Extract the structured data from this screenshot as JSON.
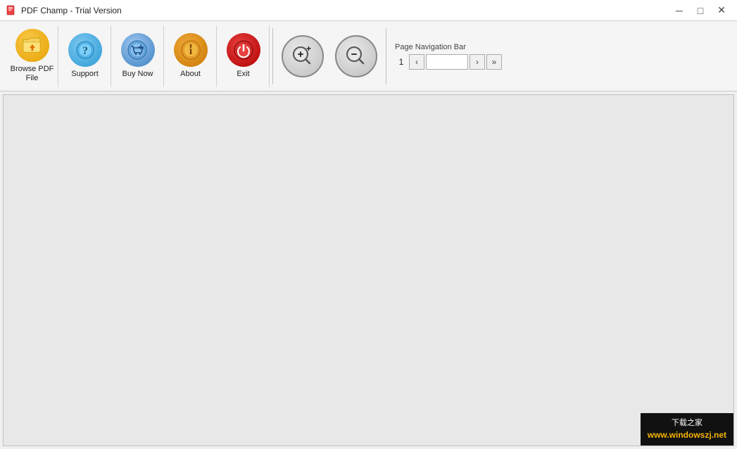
{
  "window": {
    "title": "PDF Champ - Trial Version"
  },
  "titlebar": {
    "minimize_label": "─",
    "maximize_label": "□",
    "close_label": "✕"
  },
  "toolbar": {
    "browse_label": "Browse PDF File",
    "support_label": "Support",
    "buynow_label": "Buy Now",
    "about_label": "About",
    "exit_label": "Exit"
  },
  "navigation": {
    "label": "Page Navigation Bar",
    "page_display": "1",
    "page_input_value": "",
    "prev_prev_label": "<",
    "prev_label": "‹",
    "next_label": "›",
    "next_next_label": ">"
  },
  "watermark": {
    "line1": "下载之家",
    "line2": "www.windowszj.net"
  }
}
